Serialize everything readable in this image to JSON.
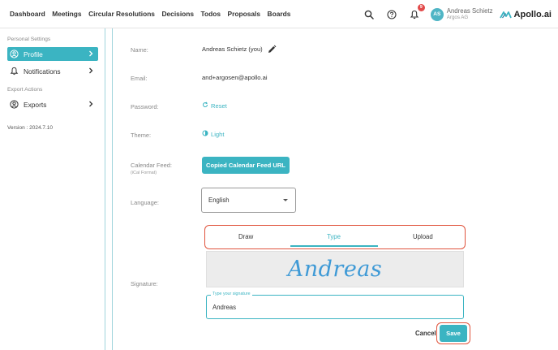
{
  "nav": {
    "items": [
      "Dashboard",
      "Meetings",
      "Circular Resolutions",
      "Decisions",
      "Todos",
      "Proposals",
      "Boards"
    ]
  },
  "header": {
    "notification_count": "9",
    "avatar_initials": "AS",
    "user_name": "Andreas Schietz",
    "user_org": "Argos AG",
    "logo_text": "Apollo.ai"
  },
  "sidebar": {
    "section_personal": "Personal Settings",
    "items": [
      {
        "label": "Profile",
        "icon": "user-circle-icon"
      },
      {
        "label": "Notifications",
        "icon": "bell-icon"
      }
    ],
    "section_export": "Export Actions",
    "export_item": {
      "label": "Exports",
      "icon": "download-circle-icon"
    },
    "version": "Version : 2024.7.10"
  },
  "profile": {
    "name_label": "Name:",
    "name_value": "Andreas Schietz (you)",
    "email_label": "Email:",
    "email_value": "and+argosen@apollo.ai",
    "password_label": "Password:",
    "password_action": "Reset",
    "theme_label": "Theme:",
    "theme_value": "Light",
    "calendar_label": "Calendar Feed:",
    "calendar_sublabel": "(iCal Format)",
    "calendar_button": "Copied Calendar Feed URL",
    "language_label": "Language:",
    "language_value": "English",
    "signature_label": "Signature:",
    "signature_tabs": [
      "Draw",
      "Type",
      "Upload"
    ],
    "signature_active_tab": "Type",
    "signature_preview": "Andreas",
    "signature_input_legend": "Type your signature",
    "signature_input_value": "Andreas",
    "cancel_label": "Cancel",
    "save_label": "Save"
  },
  "colors": {
    "accent": "#3bb4c2",
    "highlight": "#e0533c",
    "badge": "#e24a4a",
    "signature": "#3f9ad6"
  }
}
